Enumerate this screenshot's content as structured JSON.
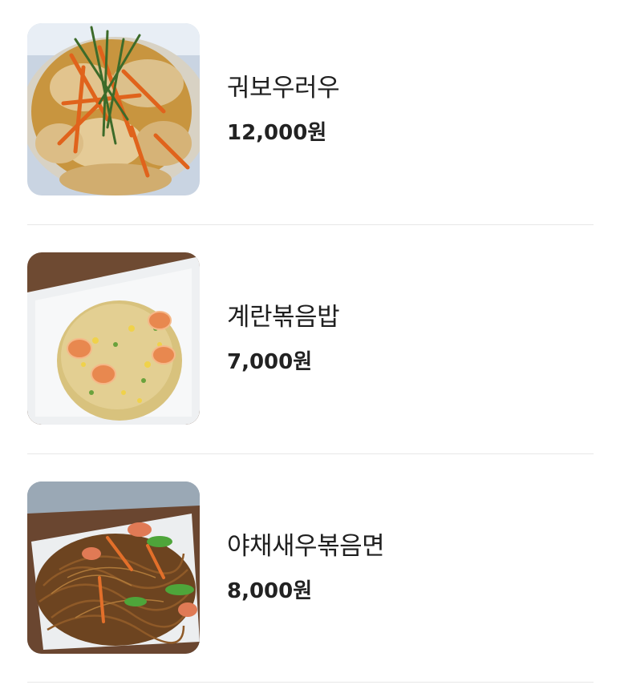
{
  "menu": {
    "items": [
      {
        "name": "궈보우러우",
        "price": "12,000원",
        "image": "crispy-pork-dish-photo"
      },
      {
        "name": "계란볶음밥",
        "price": "7,000원",
        "image": "egg-fried-rice-photo"
      },
      {
        "name": "야채새우볶음면",
        "price": "8,000원",
        "image": "vegetable-shrimp-fried-noodles-photo"
      }
    ]
  }
}
